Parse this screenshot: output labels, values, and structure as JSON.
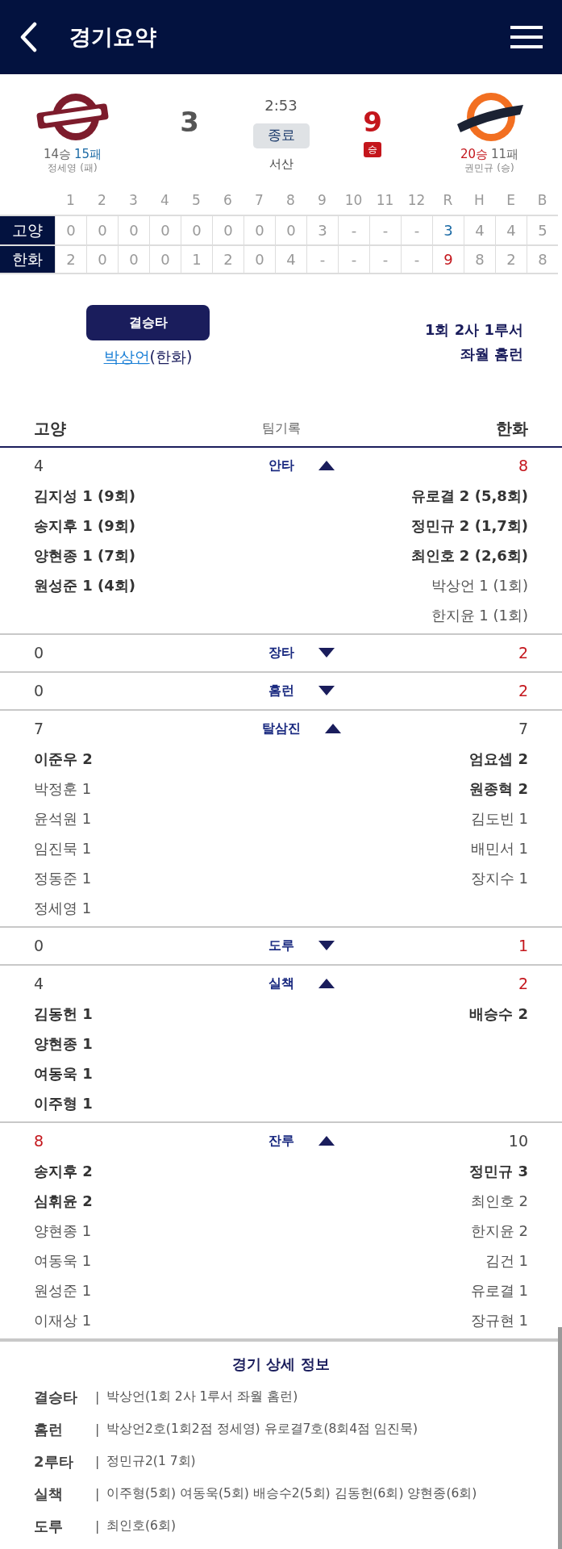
{
  "header": {
    "title": "경기요약"
  },
  "game": {
    "time": "2:53",
    "status": "종료",
    "venue": "서산"
  },
  "teams": [
    {
      "score": "3",
      "winner": false,
      "wins": "14승",
      "losses": "15패",
      "pitcher": "정세영 (패)"
    },
    {
      "score": "9",
      "winner": true,
      "badge": "승",
      "wins": "20승",
      "losses": "11패",
      "pitcher": "권민규 (승)"
    }
  ],
  "inning_table": {
    "columns": [
      "1",
      "2",
      "3",
      "4",
      "5",
      "6",
      "7",
      "8",
      "9",
      "10",
      "11",
      "12",
      "R",
      "H",
      "E",
      "B"
    ],
    "rows": [
      {
        "team": "고양",
        "cells": [
          "0",
          "0",
          "0",
          "0",
          "0",
          "0",
          "0",
          "0",
          "3",
          "-",
          "-",
          "-",
          "3",
          "4",
          "4",
          "5"
        ]
      },
      {
        "team": "한화",
        "cells": [
          "2",
          "0",
          "0",
          "0",
          "1",
          "2",
          "0",
          "4",
          "-",
          "-",
          "-",
          "-",
          "9",
          "8",
          "2",
          "8"
        ]
      }
    ]
  },
  "winning_hit": {
    "label": "결승타",
    "player": "박상언",
    "team": "(한화)",
    "description": [
      "1회 2사 1루서",
      "좌월 홈런"
    ]
  },
  "team_records": {
    "left": "고양",
    "title": "팀기록",
    "right": "한화",
    "stats": [
      {
        "label": "안타",
        "expanded": true,
        "left": {
          "count": "4",
          "highlight": false
        },
        "right": {
          "count": "8",
          "highlight": true
        },
        "left_players": [
          {
            "text": "김지성 1 (9회)",
            "bold": true
          },
          {
            "text": "송지후 1 (9회)",
            "bold": true
          },
          {
            "text": "양현종 1 (7회)",
            "bold": true
          },
          {
            "text": "원성준 1 (4회)",
            "bold": true
          }
        ],
        "right_players": [
          {
            "text": "유로결 2 (5,8회)",
            "bold": true
          },
          {
            "text": "정민규 2 (1,7회)",
            "bold": true
          },
          {
            "text": "최인호 2 (2,6회)",
            "bold": true
          },
          {
            "text": "박상언 1 (1회)",
            "bold": false
          },
          {
            "text": "한지윤 1 (1회)",
            "bold": false
          }
        ]
      },
      {
        "label": "장타",
        "expanded": false,
        "left": {
          "count": "0",
          "highlight": false
        },
        "right": {
          "count": "2",
          "highlight": true
        }
      },
      {
        "label": "홈런",
        "expanded": false,
        "left": {
          "count": "0",
          "highlight": false
        },
        "right": {
          "count": "2",
          "highlight": true
        }
      },
      {
        "label": "탈삼진",
        "expanded": true,
        "left": {
          "count": "7",
          "highlight": false
        },
        "right": {
          "count": "7",
          "highlight": false
        },
        "left_players": [
          {
            "text": "이준우 2",
            "bold": true
          },
          {
            "text": "박정훈 1",
            "bold": false
          },
          {
            "text": "윤석원 1",
            "bold": false
          },
          {
            "text": "임진묵 1",
            "bold": false
          },
          {
            "text": "정동준 1",
            "bold": false
          },
          {
            "text": "정세영 1",
            "bold": false
          }
        ],
        "right_players": [
          {
            "text": "엄요셉 2",
            "bold": true
          },
          {
            "text": "원종혁 2",
            "bold": true
          },
          {
            "text": "김도빈 1",
            "bold": false
          },
          {
            "text": "배민서 1",
            "bold": false
          },
          {
            "text": "장지수 1",
            "bold": false
          }
        ]
      },
      {
        "label": "도루",
        "expanded": false,
        "left": {
          "count": "0",
          "highlight": false
        },
        "right": {
          "count": "1",
          "highlight": true
        }
      },
      {
        "label": "실책",
        "expanded": true,
        "left": {
          "count": "4",
          "highlight": false
        },
        "right": {
          "count": "2",
          "highlight": true
        },
        "left_players": [
          {
            "text": "김동헌 1",
            "bold": true
          },
          {
            "text": "양현종 1",
            "bold": true
          },
          {
            "text": "여동욱 1",
            "bold": true
          },
          {
            "text": "이주형 1",
            "bold": true
          }
        ],
        "right_players": [
          {
            "text": "배승수 2",
            "bold": true
          }
        ]
      },
      {
        "label": "잔루",
        "expanded": true,
        "left": {
          "count": "8",
          "highlight": true
        },
        "right": {
          "count": "10",
          "highlight": false
        },
        "left_players": [
          {
            "text": "송지후 2",
            "bold": true
          },
          {
            "text": "심휘윤 2",
            "bold": true
          },
          {
            "text": "양현종 1",
            "bold": false
          },
          {
            "text": "여동욱 1",
            "bold": false
          },
          {
            "text": "원성준 1",
            "bold": false
          },
          {
            "text": "이재상 1",
            "bold": false
          }
        ],
        "right_players": [
          {
            "text": "정민규 3",
            "bold": true
          },
          {
            "text": "최인호 2",
            "bold": false
          },
          {
            "text": "한지윤 2",
            "bold": false
          },
          {
            "text": "김건 1",
            "bold": false
          },
          {
            "text": "유로결 1",
            "bold": false
          },
          {
            "text": "장규현 1",
            "bold": false
          }
        ]
      }
    ]
  },
  "details": {
    "title": "경기 상세 정보",
    "rows": [
      {
        "label": "결승타",
        "separator": "|",
        "value": "박상언(1회 2사 1루서 좌월 홈런)"
      },
      {
        "label": "홈런",
        "separator": "|",
        "value": "박상언2호(1회2점 정세영) 유로결7호(8회4점 임진묵)"
      },
      {
        "label": "2루타",
        "separator": "|",
        "value": "정민규2(1 7회)"
      },
      {
        "label": "실책",
        "separator": "|",
        "value": "이주형(5회) 여동욱(5회) 배승수2(5회) 김동헌(6회) 양현종(6회)"
      },
      {
        "label": "도루",
        "separator": "|",
        "value": "최인호(6회)"
      }
    ]
  }
}
